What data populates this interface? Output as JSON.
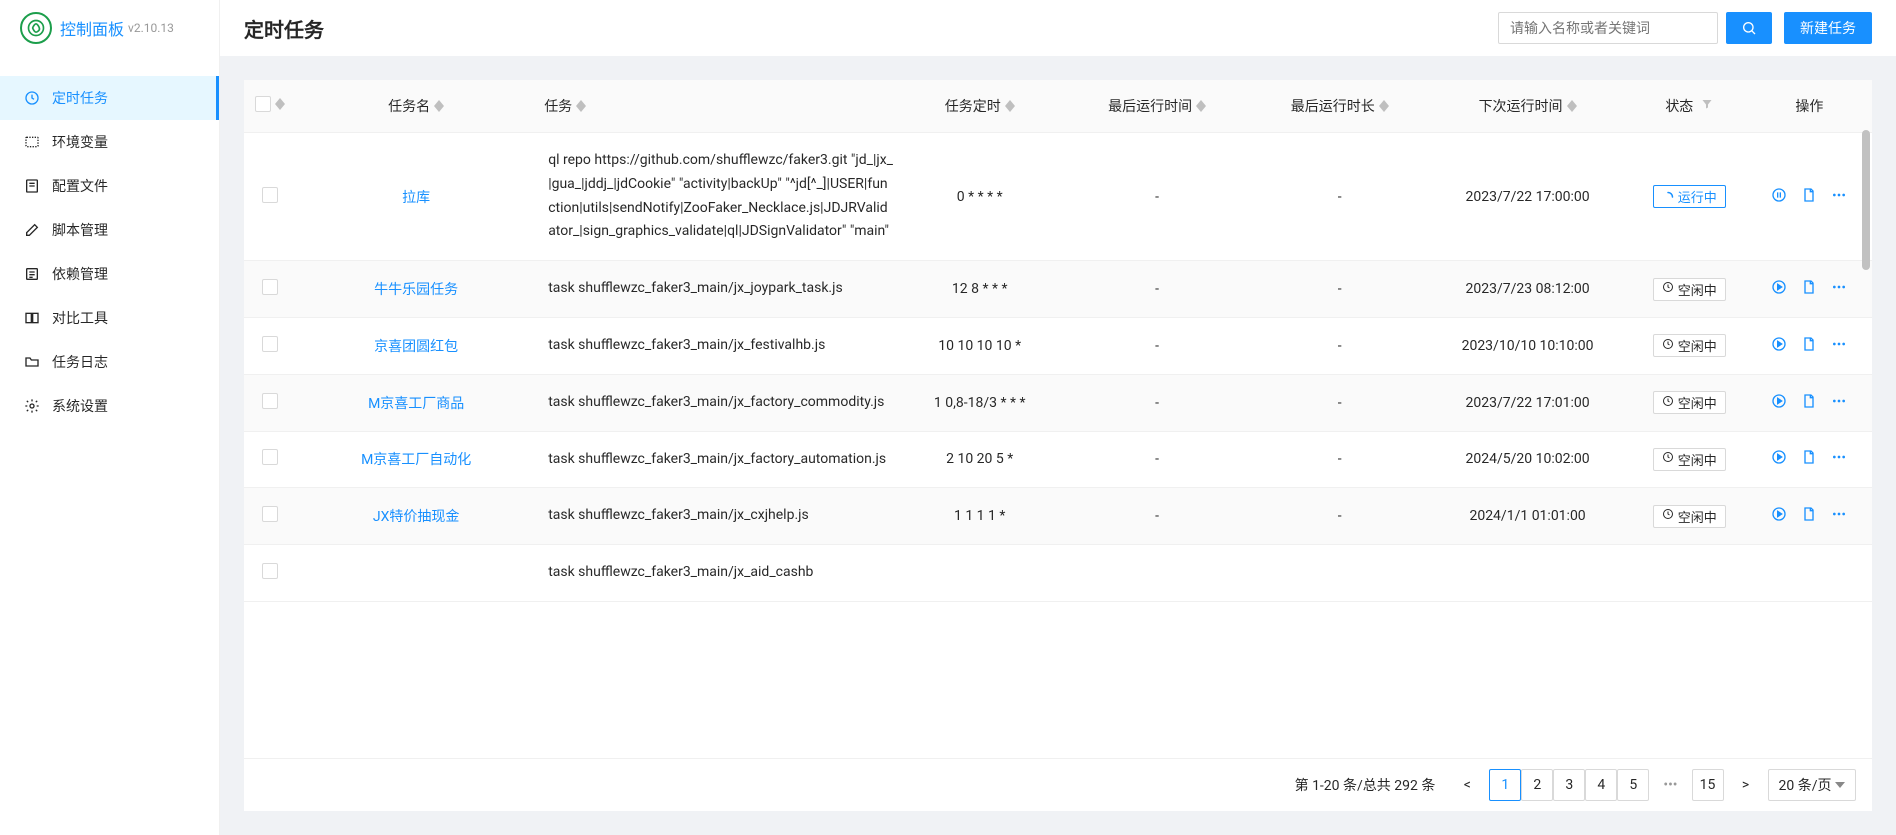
{
  "brand": {
    "title": "控制面板",
    "version": "v2.10.13"
  },
  "menu": [
    {
      "label": "定时任务",
      "icon": "clock",
      "active": true
    },
    {
      "label": "环境变量",
      "icon": "env"
    },
    {
      "label": "配置文件",
      "icon": "config"
    },
    {
      "label": "脚本管理",
      "icon": "edit"
    },
    {
      "label": "依赖管理",
      "icon": "deps"
    },
    {
      "label": "对比工具",
      "icon": "diff"
    },
    {
      "label": "任务日志",
      "icon": "folder"
    },
    {
      "label": "系统设置",
      "icon": "gear"
    }
  ],
  "header": {
    "title": "定时任务",
    "search_placeholder": "请输入名称或者关键词",
    "create_label": "新建任务"
  },
  "columns": {
    "name": "任务名",
    "task": "任务",
    "cron": "任务定时",
    "last_run": "最后运行时间",
    "duration": "最后运行时长",
    "next_run": "下次运行时间",
    "status": "状态",
    "ops": "操作"
  },
  "status_labels": {
    "running": "运行中",
    "idle": "空闲中"
  },
  "rows": [
    {
      "name": "拉库",
      "task": "ql repo https://github.com/shufflewzc/faker3.git \"jd_|jx_|gua_|jddj_|jdCookie\" \"activity|backUp\" \"^jd[^_]|USER|function|utils|sendNotify|ZooFaker_Necklace.js|JDJRValidator_|sign_graphics_validate|ql|JDSignValidator\" \"main\"",
      "cron": "0 * * * *",
      "last_run": "-",
      "duration": "-",
      "next_run": "2023/7/22 17:00:00",
      "status": "running"
    },
    {
      "name": "牛牛乐园任务",
      "task": "task shufflewzc_faker3_main/jx_joypark_task.js",
      "cron": "12 8 * * *",
      "last_run": "-",
      "duration": "-",
      "next_run": "2023/7/23 08:12:00",
      "status": "idle"
    },
    {
      "name": "京喜团圆红包",
      "task": "task shufflewzc_faker3_main/jx_festivalhb.js",
      "cron": "10 10 10 10 *",
      "last_run": "-",
      "duration": "-",
      "next_run": "2023/10/10 10:10:00",
      "status": "idle"
    },
    {
      "name": "M京喜工厂商品",
      "task": "task shufflewzc_faker3_main/jx_factory_commodity.js",
      "cron": "1 0,8-18/3 * * *",
      "last_run": "-",
      "duration": "-",
      "next_run": "2023/7/22 17:01:00",
      "status": "idle"
    },
    {
      "name": "M京喜工厂自动化",
      "task": "task shufflewzc_faker3_main/jx_factory_automation.js",
      "cron": "2 10 20 5 *",
      "last_run": "-",
      "duration": "-",
      "next_run": "2024/5/20 10:02:00",
      "status": "idle"
    },
    {
      "name": "JX特价抽现金",
      "task": "task shufflewzc_faker3_main/jx_cxjhelp.js",
      "cron": "1 1 1 1 *",
      "last_run": "-",
      "duration": "-",
      "next_run": "2024/1/1 01:01:00",
      "status": "idle"
    },
    {
      "name": "",
      "task": "task shufflewzc_faker3_main/jx_aid_cashb",
      "cron": "",
      "last_run": "",
      "duration": "",
      "next_run": "",
      "status": ""
    }
  ],
  "pagination": {
    "summary": "第 1-20 条/总共 292 条",
    "pages": [
      "1",
      "2",
      "3",
      "4",
      "5"
    ],
    "last_page": "15",
    "page_size": "20 条/页"
  }
}
